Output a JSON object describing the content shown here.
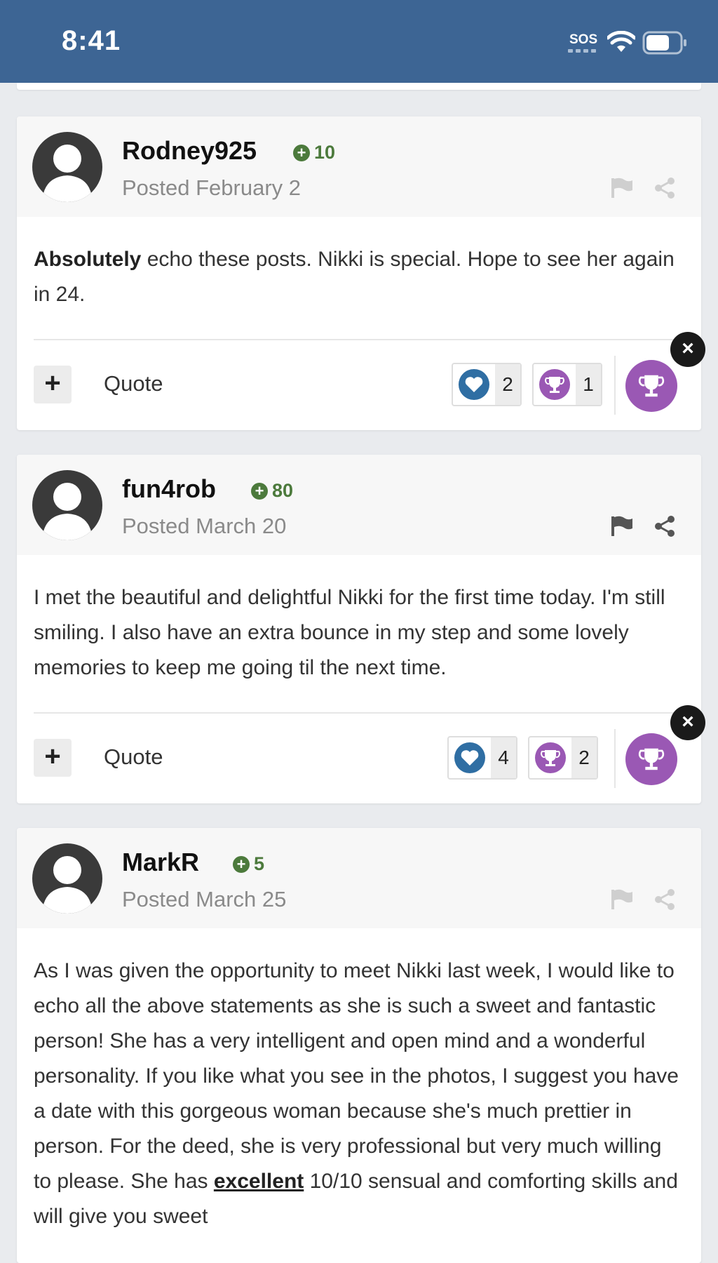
{
  "status": {
    "time": "8:41",
    "sos": "SOS"
  },
  "posts": [
    {
      "author": "Rodney925",
      "reputation": "10",
      "posted": "Posted February 2",
      "body_bold": "Absolutely",
      "body_rest": " echo these posts. Nikki is special. Hope to see her again in 24.",
      "quote_label": "Quote",
      "likes": "2",
      "trophies": "1"
    },
    {
      "author": "fun4rob",
      "reputation": "80",
      "posted": "Posted March 20",
      "body": "I met the beautiful and delightful Nikki for the first time today. I'm still smiling. I also have an extra bounce in my step and some lovely memories to keep me going til the next time.",
      "quote_label": "Quote",
      "likes": "4",
      "trophies": "2"
    },
    {
      "author": "MarkR",
      "reputation": "5",
      "posted": "Posted March 25",
      "body": "As I was given the opportunity to meet Nikki last week, I would like to echo all the above statements as she is such a sweet and fantastic person! She has a very intelligent and open mind and a wonderful personality. If you like what you see in the photos, I suggest you have a date with this gorgeous woman because she's much prettier in person. For the deed, she is very professional but very much willing to please. She has ",
      "body_emphasis": "excellent",
      "body_tail": " 10/10 sensual and comforting skills and will give you sweet"
    }
  ],
  "colors": {
    "statusbar": "#3d6594",
    "reputation": "#4c7a3c",
    "like": "#2f6ea3",
    "trophy": "#9a58b4"
  },
  "icons": [
    "wifi-icon",
    "battery-icon",
    "flag-icon",
    "share-icon",
    "heart-icon",
    "trophy-icon",
    "close-icon",
    "plus-icon",
    "avatar-icon"
  ]
}
